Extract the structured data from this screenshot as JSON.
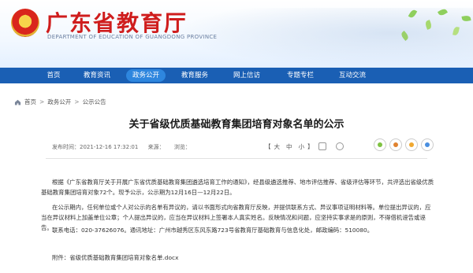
{
  "header": {
    "title": "广东省教育厅",
    "subtitle": "DEPARTMENT OF EDUCATION OF GUANGDONG PROVINCE",
    "emblem_icon": "national-emblem-icon"
  },
  "nav": {
    "items": [
      {
        "label": "首页"
      },
      {
        "label": "教育资讯"
      },
      {
        "label": "政务公开"
      },
      {
        "label": "教育服务"
      },
      {
        "label": "网上信访"
      },
      {
        "label": "专题专栏"
      },
      {
        "label": "互动交流"
      }
    ],
    "active_index": 2,
    "active_color": "#2e86de",
    "bar_color": "#1a5fb4"
  },
  "breadcrumb": {
    "items": [
      "首页",
      "政务公开",
      "公示公告"
    ],
    "separator": ">"
  },
  "article": {
    "title": "关于省级优质基础教育集团培育对象名单的公示",
    "date": "发布时间：2021-12-16 17:32:01",
    "source": "来源：",
    "views": "浏览：",
    "font_size_label": "【",
    "font_sizes": [
      "大",
      "中",
      "小"
    ],
    "font_size_close": "】",
    "paragraphs": [
      "根据《广东省教育厅关于开展广东省优质基础教育集团遴选培育工作的通知》，经县级遴选推荐、地市评估推荐、省级评估等环节，共评选出省级优质基础教育集团培育对象72个。现予公示，公示期为12月16日—12月22日。",
      "在公示期内，任何单位或个人对公示的名单有异议的，请以书面形式向省教育厅反映，并提供联系方式、异议事项证明材料等。单位提出异议的，应当在异议材料上加盖单位公章；个人提出异议的，应当在异议材料上签署本人真实姓名。反映情况和问题，应坚持实事求是的原则，不得借机诬告或诬告。",
      "联系电话：020-37626076。通讯地址：广州市越秀区东风东路723号省教育厅基础教育与信息化处，邮政编码：510080。"
    ],
    "attachment_label": "附件：",
    "attachment_name": "省级优质基础教育集团培育对象名单.docx"
  },
  "share": {
    "icons": [
      "wechat-icon",
      "weibo-icon",
      "qzone-icon",
      "qq-icon"
    ]
  },
  "colors": {
    "title_red": "#cf1d1d",
    "nav_blue": "#1a5fb4"
  }
}
